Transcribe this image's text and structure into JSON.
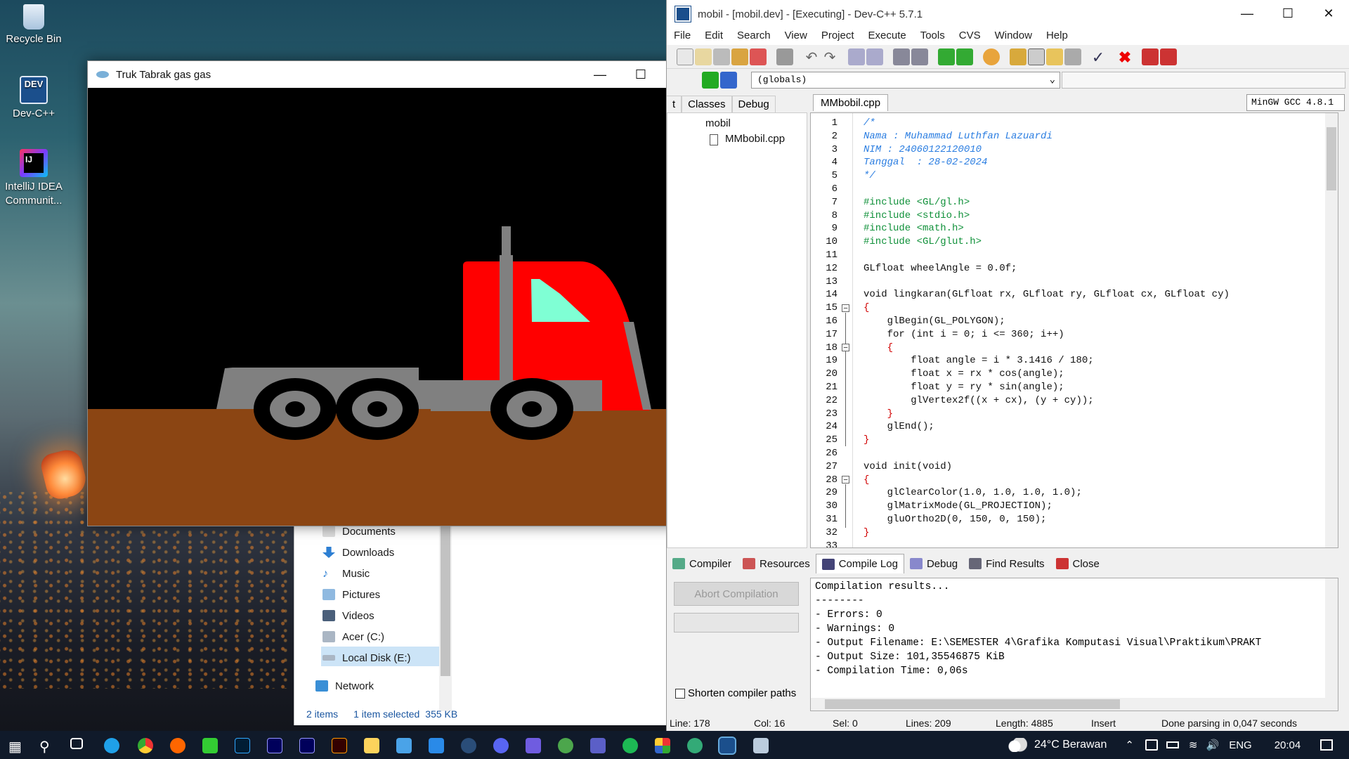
{
  "desktop": {
    "icons": [
      {
        "label": "Recycle Bin"
      },
      {
        "label": "Dev-C++"
      },
      {
        "label": "IntelliJ IDEA Communit..."
      }
    ]
  },
  "explorer": {
    "nav": [
      "Documents",
      "Downloads",
      "Music",
      "Pictures",
      "Videos",
      "Acer (C:)",
      "Local Disk (E:)",
      "Network"
    ],
    "status_items": "2 items",
    "status_selected": "1 item selected",
    "status_size": "355 KB"
  },
  "gl_window": {
    "title": "Truk Tabrak gas gas",
    "colors": {
      "sky": "#000000",
      "ground": "#8b4513",
      "cab": "#ff0000",
      "window": "#7fffd4",
      "chassis": "#808080",
      "tire": "#000000",
      "rim": "#808080"
    }
  },
  "devcpp": {
    "title": "mobil - [mobil.dev] - [Executing] - Dev-C++ 5.7.1",
    "menu": [
      "File",
      "Edit",
      "Search",
      "View",
      "Project",
      "Execute",
      "Tools",
      "CVS",
      "Window",
      "Help"
    ],
    "compiler": "MinGW GCC 4.8.1",
    "globals": "(globals)",
    "left_tabs": [
      "t",
      "Classes",
      "Debug"
    ],
    "project": "mobil",
    "file": "MMbobil.cpp",
    "editor_tab": "MMbobil.cpp",
    "lines": [
      "1",
      "2",
      "3",
      "4",
      "5",
      "6",
      "7",
      "8",
      "9",
      "10",
      "11",
      "12",
      "13",
      "14",
      "15",
      "16",
      "17",
      "18",
      "19",
      "20",
      "21",
      "22",
      "23",
      "24",
      "25",
      "26",
      "27",
      "28",
      "29",
      "30",
      "31",
      "32",
      "33"
    ],
    "code": [
      "/*",
      "Nama : Muhammad Luthfan Lazuardi",
      "NIM : 24060122120010",
      "Tanggal  : 28-02-2024",
      "*/",
      "",
      "#include <GL/gl.h>",
      "#include <stdio.h>",
      "#include <math.h>",
      "#include <GL/glut.h>",
      "",
      "GLfloat wheelAngle = 0.0f;",
      "",
      "void lingkaran(GLfloat rx, GLfloat ry, GLfloat cx, GLfloat cy)",
      "{",
      "    glBegin(GL_POLYGON);",
      "    for (int i = 0; i <= 360; i++)",
      "    {",
      "        float angle = i * 3.1416 / 180;",
      "        float x = rx * cos(angle);",
      "        float y = ry * sin(angle);",
      "        glVertex2f((x + cx), (y + cy));",
      "    }",
      "    glEnd();",
      "}",
      "",
      "void init(void)",
      "{",
      "    glClearColor(1.0, 1.0, 1.0, 1.0);",
      "    glMatrixMode(GL_PROJECTION);",
      "    gluOrtho2D(0, 150, 0, 150);",
      "}",
      ""
    ],
    "bottom_tabs": [
      "Compiler",
      "Resources",
      "Compile Log",
      "Debug",
      "Find Results",
      "Close"
    ],
    "abort_label": "Abort Compilation",
    "shorten_label": "Shorten compiler paths",
    "log": [
      "Compilation results...",
      "--------",
      "- Errors: 0",
      "- Warnings: 0",
      "- Output Filename: E:\\SEMESTER 4\\Grafika Komputasi Visual\\Praktikum\\PRAKT",
      "- Output Size: 101,35546875 KiB",
      "- Compilation Time: 0,06s"
    ],
    "status": {
      "line": "Line:   178",
      "col": "Col:   16",
      "sel": "Sel:    0",
      "lines": "Lines:   209",
      "length": "Length:  4885",
      "mode": "Insert",
      "parse": "Done parsing in 0,047 seconds"
    }
  },
  "taskbar": {
    "weather": "24°C  Berawan",
    "lang": "ENG",
    "time": "20:04"
  }
}
